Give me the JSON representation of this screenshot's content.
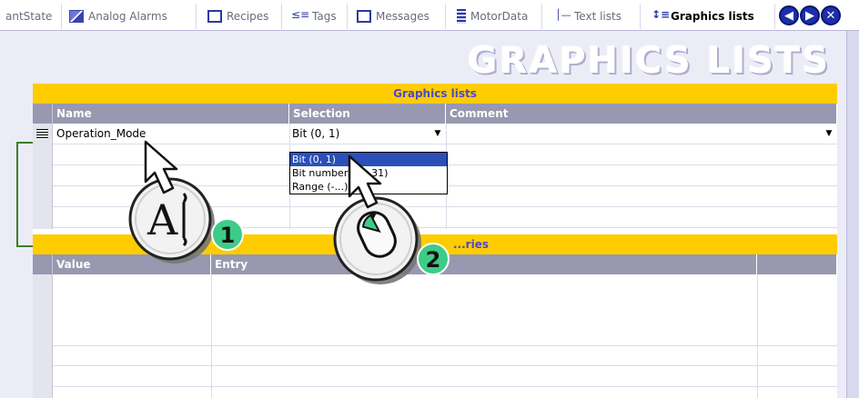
{
  "tabs": [
    {
      "label": "antState",
      "icon": "none"
    },
    {
      "label": "Analog Alarms",
      "icon": "analog-alarm-icon"
    },
    {
      "label": "Recipes",
      "icon": "window-icon"
    },
    {
      "label": "Tags",
      "icon": "tags-icon"
    },
    {
      "label": "Messages",
      "icon": "window-icon"
    },
    {
      "label": "MotorData",
      "icon": "document-icon"
    },
    {
      "label": "Text lists",
      "icon": "text-list-icon"
    },
    {
      "label": "Graphics lists",
      "icon": "graphics-list-icon",
      "active": true
    }
  ],
  "nav": {
    "prev": "◀",
    "next": "▶",
    "close": "✕"
  },
  "page_title": "GRAPHICS LISTS",
  "graphics_lists": {
    "title": "Graphics lists",
    "columns": [
      "Name",
      "Selection",
      "Comment"
    ],
    "rows": [
      {
        "name": "Operation_Mode",
        "selection": "Bit (0, 1)",
        "comment": ""
      }
    ]
  },
  "selection_dropdown": {
    "options": [
      "Bit (0, 1)",
      "Bit number (0 - 31)",
      "Range (-...)"
    ],
    "selected": "Bit (0, 1)"
  },
  "entries": {
    "title": "...ries",
    "columns": [
      "Value",
      "Entry"
    ]
  },
  "callouts": [
    {
      "number": "1",
      "icon": "text-cursor-icon",
      "glyph": "A"
    },
    {
      "number": "2",
      "icon": "mouse-click-icon"
    }
  ],
  "colors": {
    "accent": "#ffcc00",
    "header": "#9898b0",
    "badge": "#3dcc88",
    "selection": "#2a4fb8"
  }
}
